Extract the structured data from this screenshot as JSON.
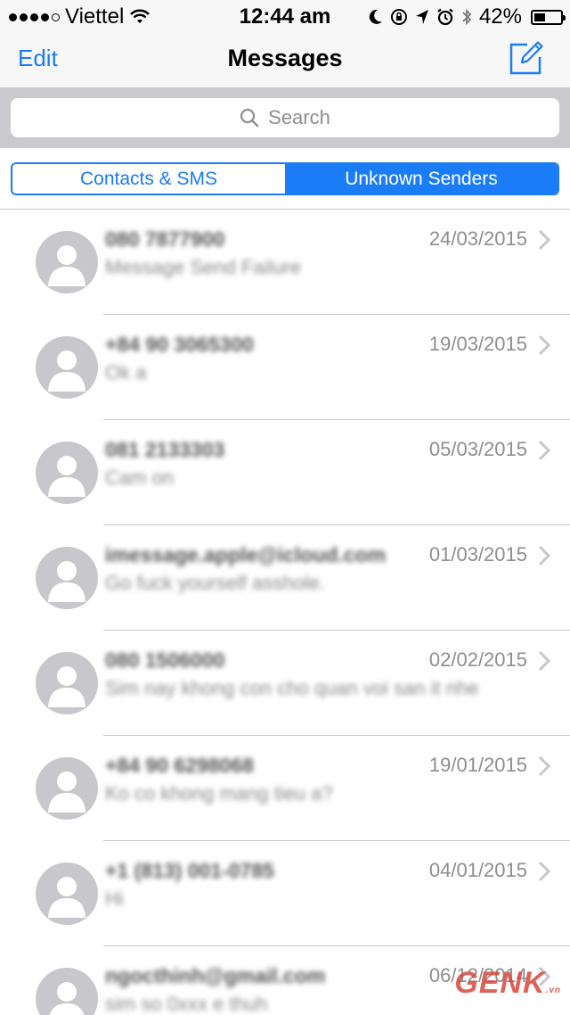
{
  "status": {
    "carrier": "Viettel",
    "time": "12:44 am",
    "battery": "42%",
    "battery_level": 0.42,
    "signal_bars": 4
  },
  "nav": {
    "edit": "Edit",
    "title": "Messages"
  },
  "search": {
    "placeholder": "Search"
  },
  "segments": {
    "contacts": "Contacts & SMS",
    "unknown": "Unknown Senders",
    "selected": "Unknown Senders"
  },
  "messages": [
    {
      "sender": "080 7877900",
      "preview": "Message Send Failure",
      "date": "24/03/2015"
    },
    {
      "sender": "+84 90 3065300",
      "preview": "Ok a",
      "date": "19/03/2015"
    },
    {
      "sender": "081 2133303",
      "preview": "Cam on",
      "date": "05/03/2015"
    },
    {
      "sender": "imessage.apple@icloud.com",
      "preview": "Go fuck yourself asshole.",
      "date": "01/03/2015"
    },
    {
      "sender": "080 1506000",
      "preview": "Sim nay khong con cho quan voi san it nhe",
      "date": "02/02/2015"
    },
    {
      "sender": "+84 90 6298068",
      "preview": "Ko co khong mang tieu a?",
      "date": "19/01/2015"
    },
    {
      "sender": "+1 (813) 001-0785",
      "preview": "Hi",
      "date": "04/01/2015"
    },
    {
      "sender": "ngocthinh@gmail.com",
      "preview": "sim so 0xxx e thuh",
      "date": "06/12/2014"
    }
  ],
  "watermark": {
    "brand": "GENK",
    "suffix": ".vn"
  },
  "colors": {
    "accent": "#1a7cf7",
    "avatar": "#c7c7cc",
    "secondary_text": "#8e8e93"
  },
  "icons": {
    "compose": "compose-icon",
    "search": "magnifier-icon",
    "chevron": "chevron-right-icon",
    "avatar": "person-silhouette-icon"
  }
}
